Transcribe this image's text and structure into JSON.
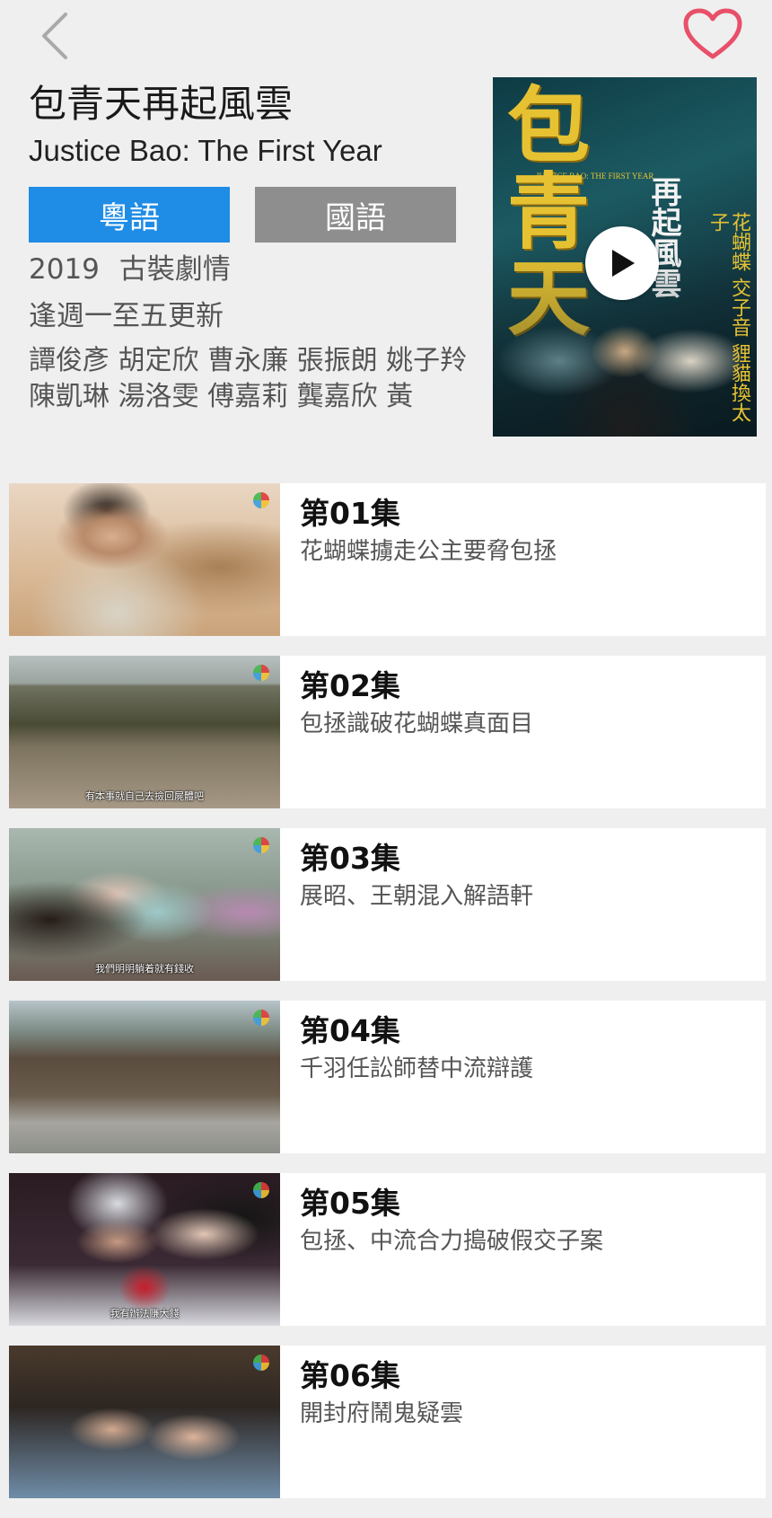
{
  "nav": {
    "back_icon": "chevron-left-icon",
    "favorite_icon": "heart-outline-icon",
    "favorite_color": "#e8506a"
  },
  "show": {
    "title_zh": "包青天再起風雲",
    "title_en": "Justice Bao: The First Year",
    "year": "2019",
    "genre": "古裝劇情",
    "schedule": "逢週一至五更新",
    "cast": "譚俊彥 胡定欣 曹永廉 張振朗 姚子羚 陳凱琳 湯洛雯 傅嘉莉 龔嘉欣 黃"
  },
  "language_buttons": [
    {
      "label": "粵語",
      "selected": true,
      "color": "#1f8ce6"
    },
    {
      "label": "國語",
      "selected": false,
      "color": "#8e8e8e"
    }
  ],
  "poster": {
    "title": "包青天",
    "subtitle": "再起風雲",
    "english": "JUSTICE BAO: THE FIRST YEAR",
    "side_text": "花蝴蝶 交子音 貍貓換太子",
    "play_icon": "play-icon"
  },
  "episodes": [
    {
      "number": "第01集",
      "title": "花蝴蝶擄走公主要脅包拯",
      "caption": ""
    },
    {
      "number": "第02集",
      "title": "包拯識破花蝴蝶真面目",
      "caption": "有本事就自己去撿回屍體吧"
    },
    {
      "number": "第03集",
      "title": "展昭、王朝混入解語軒",
      "caption": "我們明明躺着就有錢收"
    },
    {
      "number": "第04集",
      "title": "千羽任訟師替中流辯護",
      "caption": ""
    },
    {
      "number": "第05集",
      "title": "包拯、中流合力搗破假交子案",
      "caption": "我有辦法賺大錢"
    },
    {
      "number": "第06集",
      "title": "開封府鬧鬼疑雲",
      "caption": ""
    }
  ]
}
